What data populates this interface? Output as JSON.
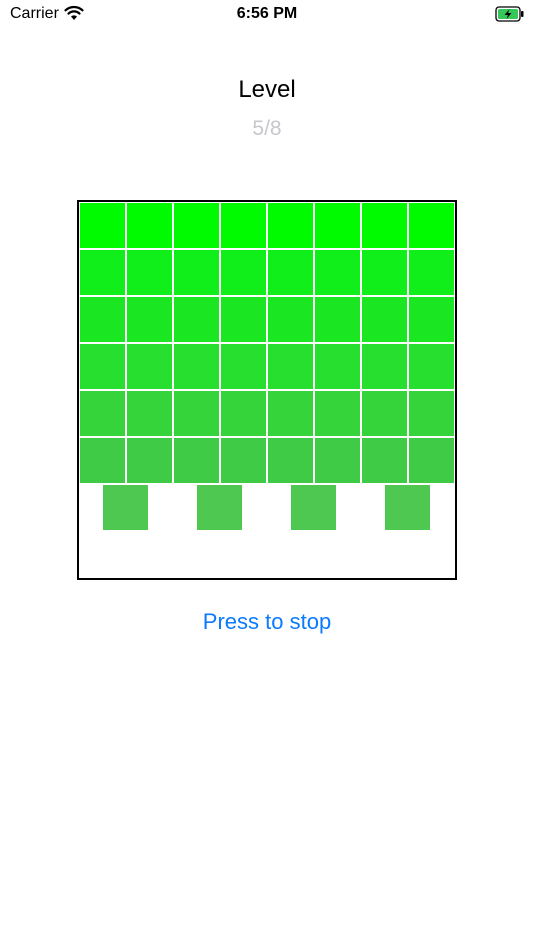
{
  "status_bar": {
    "carrier": "Carrier",
    "time": "6:56 PM",
    "wifi_icon": "wifi-icon",
    "battery_icon": "battery-charging-icon",
    "battery_color": "#34c759"
  },
  "header": {
    "title": "Level",
    "level": "5/8"
  },
  "board": {
    "columns": 8,
    "stacked_rows": 6,
    "row_colors": [
      "#00fb00",
      "#10ef19",
      "#1ae722",
      "#27df2e",
      "#35d43b",
      "#40cb47"
    ],
    "sliding_row": {
      "blocks": 4,
      "color": "#4ec850"
    }
  },
  "controls": {
    "stop_label": "Press to stop",
    "accent_color": "#0a7aff"
  }
}
